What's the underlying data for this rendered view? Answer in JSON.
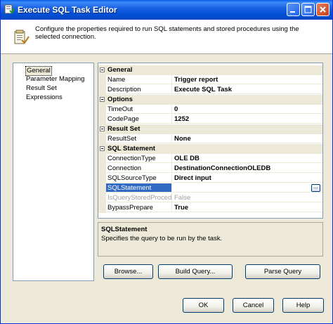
{
  "window": {
    "title": "Execute SQL Task Editor"
  },
  "header": {
    "description": "Configure the properties required to run SQL statements and stored procedures using the selected connection."
  },
  "nav": {
    "items": [
      {
        "label": "General",
        "selected": true
      },
      {
        "label": "Parameter Mapping"
      },
      {
        "label": "Result Set"
      },
      {
        "label": "Expressions"
      }
    ]
  },
  "grid": {
    "general": {
      "category": "General",
      "name_label": "Name",
      "name_value": "Trigger report",
      "desc_label": "Description",
      "desc_value": "Execute SQL Task"
    },
    "options": {
      "category": "Options",
      "timeout_label": "TimeOut",
      "timeout_value": "0",
      "codepage_label": "CodePage",
      "codepage_value": "1252"
    },
    "result": {
      "category": "Result Set",
      "resultset_label": "ResultSet",
      "resultset_value": "None"
    },
    "sql": {
      "category": "SQL Statement",
      "conntype_label": "ConnectionType",
      "conntype_value": "OLE DB",
      "conn_label": "Connection",
      "conn_value": "DestinationConnectionOLEDB",
      "srctype_label": "SQLSourceType",
      "srctype_value": "Direct input",
      "stmt_label": "SQLStatement",
      "stmt_value": "",
      "ellipsis": "...",
      "isstored_label": "IsQueryStoredProcedu",
      "isstored_value": "False",
      "bypass_label": "BypassPrepare",
      "bypass_value": "True"
    }
  },
  "description_panel": {
    "title": "SQLStatement",
    "text": "Specifies the query to be run by the task."
  },
  "buttons": {
    "browse": "Browse...",
    "build_query": "Build Query...",
    "parse_query": "Parse Query",
    "ok": "OK",
    "cancel": "Cancel",
    "help": "Help"
  }
}
